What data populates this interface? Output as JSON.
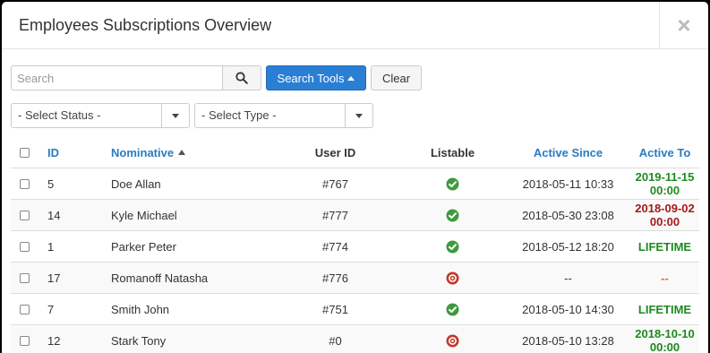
{
  "modal": {
    "title": "Employees Subscriptions Overview",
    "close_label": "×"
  },
  "toolbar": {
    "search_placeholder": "Search",
    "search_value": "",
    "search_tools_label": "Search Tools",
    "clear_label": "Clear"
  },
  "filters": {
    "status": {
      "selected": "- Select Status -"
    },
    "type": {
      "selected": "- Select Type -"
    }
  },
  "table": {
    "columns": {
      "id": "ID",
      "nominative": "Nominative",
      "user_id": "User ID",
      "listable": "Listable",
      "active_since": "Active Since",
      "active_to": "Active To"
    },
    "sorted_column": "nominative",
    "sort_direction": "asc",
    "rows": [
      {
        "id": "5",
        "nominative": "Doe Allan",
        "user_id": "#767",
        "listable": true,
        "active_since": "2018-05-11 10:33",
        "active_to": "2019-11-15 00:00",
        "active_to_status": "green"
      },
      {
        "id": "14",
        "nominative": "Kyle Michael",
        "user_id": "#777",
        "listable": true,
        "active_since": "2018-05-30 23:08",
        "active_to": "2018-09-02 00:00",
        "active_to_status": "red"
      },
      {
        "id": "1",
        "nominative": "Parker Peter",
        "user_id": "#774",
        "listable": true,
        "active_since": "2018-05-12 18:20",
        "active_to": "LIFETIME",
        "active_to_status": "green"
      },
      {
        "id": "17",
        "nominative": "Romanoff Natasha",
        "user_id": "#776",
        "listable": false,
        "active_since": "--",
        "active_to": "--",
        "active_to_status": "orange"
      },
      {
        "id": "7",
        "nominative": "Smith John",
        "user_id": "#751",
        "listable": true,
        "active_since": "2018-05-10 14:30",
        "active_to": "LIFETIME",
        "active_to_status": "green"
      },
      {
        "id": "12",
        "nominative": "Stark Tony",
        "user_id": "#0",
        "listable": false,
        "active_since": "2018-05-10 13:28",
        "active_to": "2018-10-10 00:00",
        "active_to_status": "green"
      }
    ]
  },
  "colors": {
    "primary": "#2a7fd4",
    "link": "#2a7bc0",
    "ok_green": "#3e9a3e",
    "error_red": "#c0392b",
    "to_green": "#1e8a1e",
    "to_red": "#a31a1a",
    "to_orange": "#f0642a"
  }
}
